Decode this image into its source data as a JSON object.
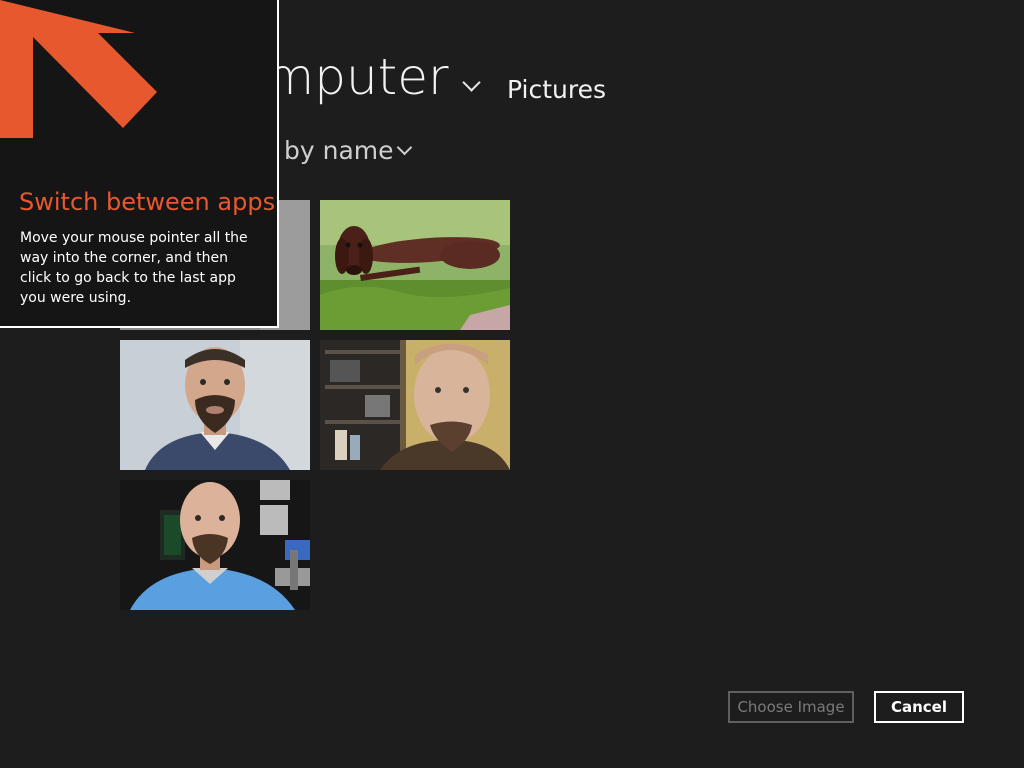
{
  "header": {
    "location_title": "Computer",
    "folder": "Pictures",
    "sort_label": "by name"
  },
  "thumbnails": [
    {
      "subject": "dog-lying-in-grass"
    },
    {
      "subject": "man-with-goatee-portrait"
    },
    {
      "subject": "man-selfie-with-shelves"
    },
    {
      "subject": "man-in-blue-shirt-with-microphone"
    }
  ],
  "tip": {
    "title": "Switch between apps",
    "body": "Move your mouse pointer all the way into the corner, and then click to go back to the last app you were using.",
    "accent_color": "#e8582f",
    "icon": "corner-arrow-icon"
  },
  "actions": {
    "choose_label": "Choose Image",
    "cancel_label": "Cancel"
  },
  "colors": {
    "background": "#1d1d1d",
    "tip_background": "#151515",
    "accent": "#e8582f"
  }
}
